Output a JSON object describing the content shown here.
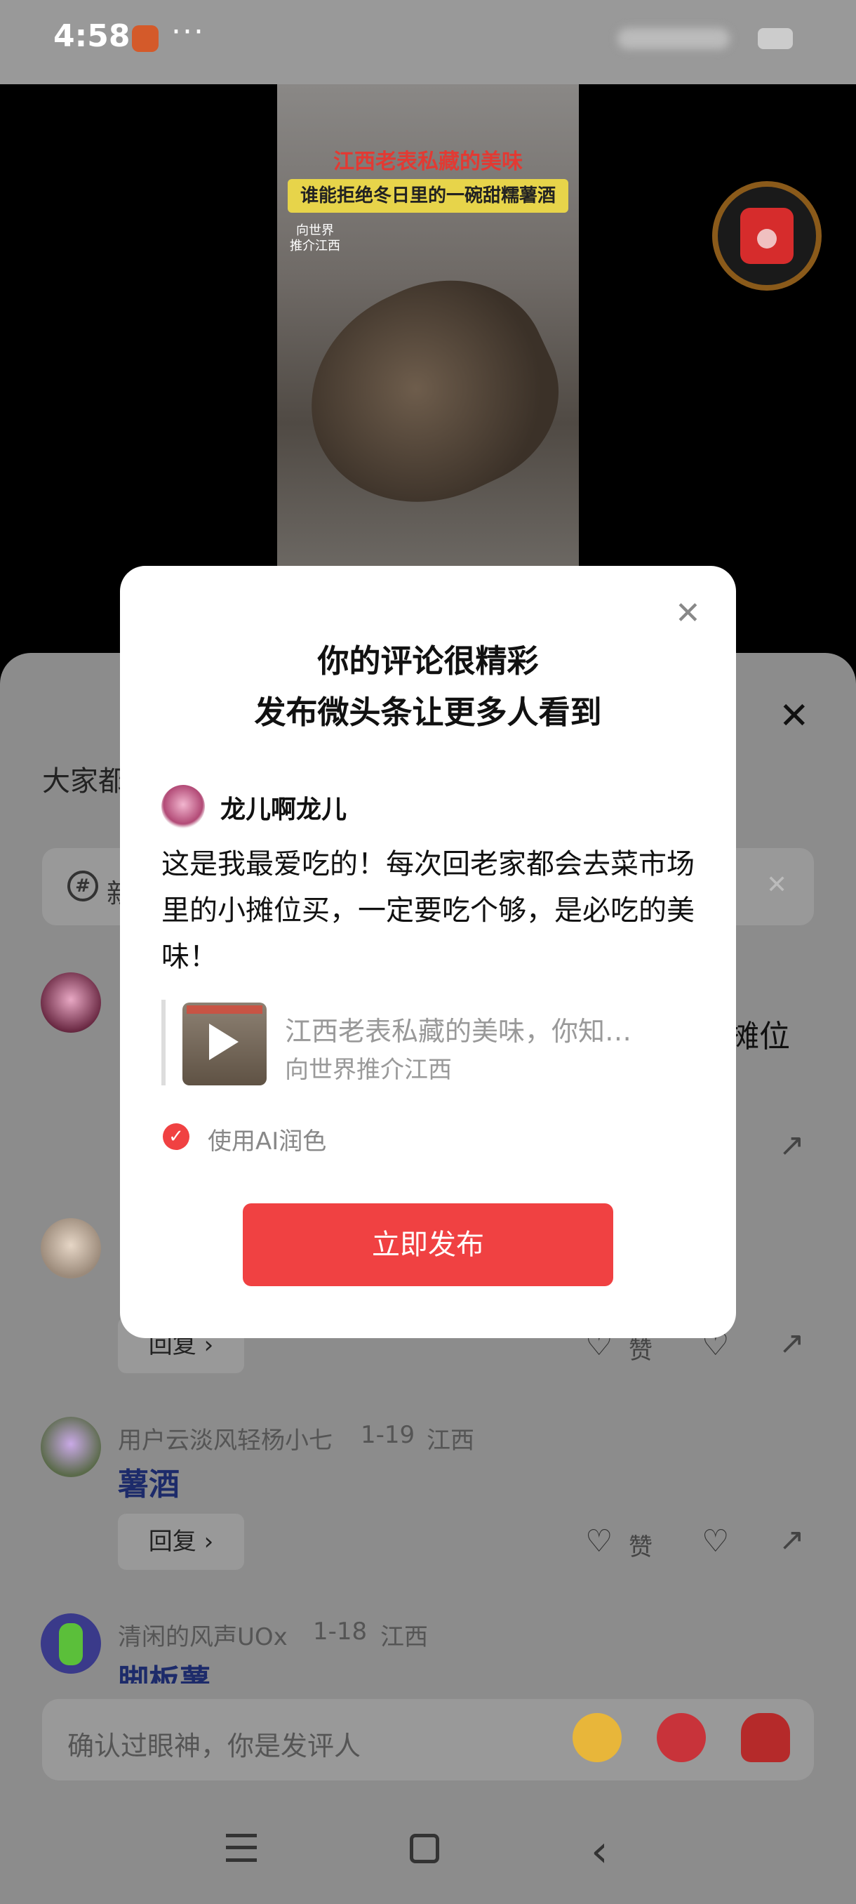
{
  "status_bar": {
    "time": "4:58",
    "menu_dots": "···"
  },
  "video": {
    "title": "江西老表私藏的美味",
    "subtitle": "谁能拒绝冬日里的一碗甜糯薯酒",
    "watermark": "向世界\n推介江西"
  },
  "sheet": {
    "close_glyph": "✕",
    "header_text": "大家都",
    "topic": {
      "icon": "#",
      "text": "新",
      "close": "✕"
    },
    "comments": [
      {
        "text_right": "摊位"
      },
      {
        "reply": "回复 ›",
        "like": "赞"
      },
      {
        "user": "用户云淡风轻杨小七",
        "date": "1-19",
        "location": "江西",
        "text": "薯酒",
        "reply": "回复 ›",
        "like": "赞"
      },
      {
        "user": "清闲的风声UOx",
        "date": "1-18",
        "location": "江西",
        "text": "脚板薯"
      }
    ],
    "input_placeholder": "确认过眼神，你是发评人"
  },
  "modal": {
    "close_glyph": "✕",
    "title_line1": "你的评论很精彩",
    "title_line2": "发布微头条让更多人看到",
    "username": "龙儿啊龙儿",
    "comment": "这是我最爱吃的！每次回老家都会去菜市场里的小摊位买，一定要吃个够，是必吃的美味！",
    "quote_title": "江西老表私藏的美味，你知…",
    "quote_source": "向世界推介江西",
    "ai_checked": true,
    "ai_label": "使用AI润色",
    "publish_label": "立即发布"
  },
  "colors": {
    "accent": "#f04142",
    "dim_overlay": "#8c8c8c"
  }
}
